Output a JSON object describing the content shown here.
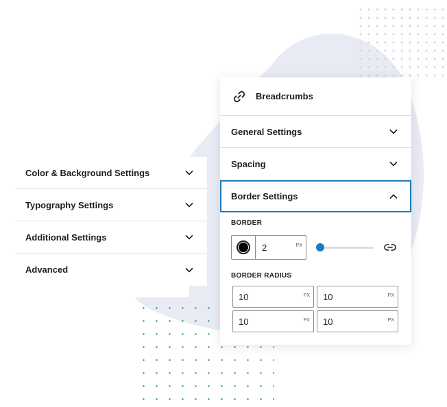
{
  "left_panel": {
    "items": [
      {
        "label": "Color & Background Settings"
      },
      {
        "label": "Typography Settings"
      },
      {
        "label": "Additional Settings"
      },
      {
        "label": "Advanced"
      }
    ]
  },
  "card": {
    "title": "Breadcrumbs",
    "title_icon": "link-icon",
    "sections": [
      {
        "label": "General Settings",
        "state": "collapsed"
      },
      {
        "label": "Spacing",
        "state": "collapsed"
      },
      {
        "label": "Border Settings",
        "state": "expanded"
      }
    ],
    "border": {
      "label": "BORDER",
      "color": "#000000",
      "width_value": "2",
      "unit": "PX",
      "slider_level": 0
    },
    "border_radius": {
      "label": "BORDER RADIUS",
      "fields": [
        {
          "value": "10",
          "unit": "PX"
        },
        {
          "value": "10",
          "unit": "PX"
        },
        {
          "value": "10",
          "unit": "PX"
        },
        {
          "value": "10",
          "unit": "PX"
        }
      ]
    }
  },
  "colors": {
    "accent": "#1e7bbd",
    "blob": "#e9ebf4",
    "dots_green": "#2a9d6a"
  }
}
